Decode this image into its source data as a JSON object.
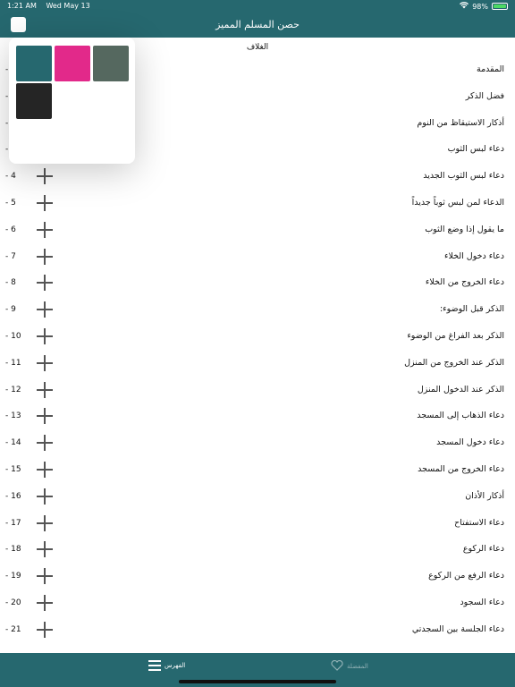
{
  "status": {
    "time": "1:21 AM",
    "date": "Wed May 13",
    "battery": "98%",
    "battery_level": 0.98
  },
  "nav": {
    "title": "حصن المسلم المميز"
  },
  "cover": "الغلاف",
  "colors": {
    "teal": "#26686f",
    "pink": "#e2298a",
    "gray_green": "#55685f",
    "black": "#252525"
  },
  "swatches": [
    "#26686f",
    "#e2298a",
    "#55685f",
    "#252525"
  ],
  "items": [
    {
      "num": "-",
      "title": "المقدمة"
    },
    {
      "num": "-",
      "title": "فضل الذكر"
    },
    {
      "num": "-",
      "title": "أذكار الاستيقاظ من النوم"
    },
    {
      "num": "-",
      "title": "دعاء لبس الثوب"
    },
    {
      "num": "- 4",
      "title": "دعاء لبس الثوب الجديد"
    },
    {
      "num": "- 5",
      "title": "الدعاء لمن لبس ثوباً جديداً"
    },
    {
      "num": "- 6",
      "title": "ما يقول إذا وضع الثوب"
    },
    {
      "num": "- 7",
      "title": "دعاء دخول الخلاء"
    },
    {
      "num": "- 8",
      "title": "دعاء الخروج من الخلاء"
    },
    {
      "num": "- 9",
      "title": "الذكر قبل الوضوء:"
    },
    {
      "num": "- 10",
      "title": "الذكر بعد الفراغ من الوضوء"
    },
    {
      "num": "- 11",
      "title": "الذكر عند الخروج من المنزل"
    },
    {
      "num": "- 12",
      "title": "الذكر عند الدخول المنزل"
    },
    {
      "num": "- 13",
      "title": "دعاء الذهاب إلى المسجد"
    },
    {
      "num": "- 14",
      "title": "دعاء دخول المسجد"
    },
    {
      "num": "- 15",
      "title": "دعاء الخروج من المسجد"
    },
    {
      "num": "- 16",
      "title": "أذكار الأذان"
    },
    {
      "num": "- 17",
      "title": "دعاء الاستفتاح"
    },
    {
      "num": "- 18",
      "title": "دعاء الركوع"
    },
    {
      "num": "- 19",
      "title": "دعاء  الرفع من الركوع"
    },
    {
      "num": "- 20",
      "title": "دعاء السجود"
    },
    {
      "num": "- 21",
      "title": "دعاء الجلسة بين السجدتي"
    }
  ],
  "tabs": {
    "index": "الفهرس",
    "favorites": "المفضلة"
  }
}
